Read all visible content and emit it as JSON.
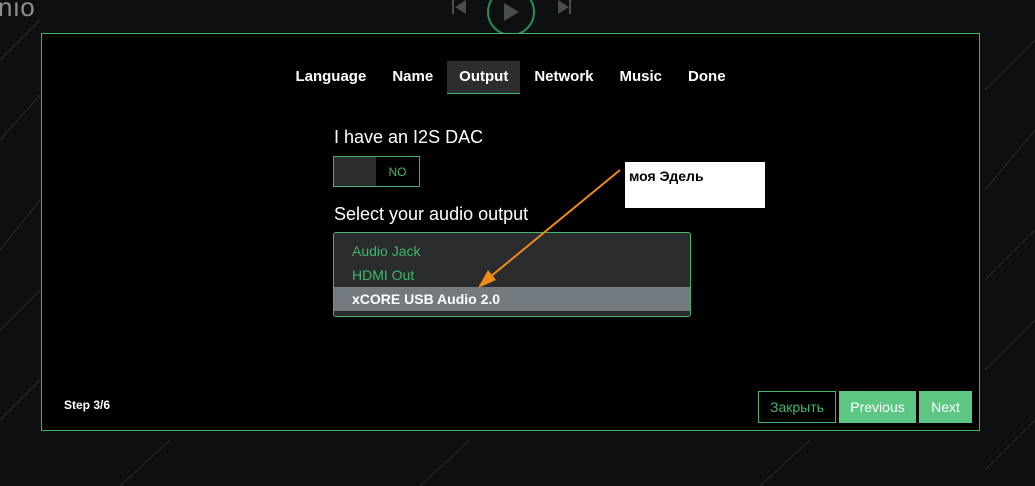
{
  "app": {
    "logo_text": "nio"
  },
  "tabs": [
    {
      "label": "Language"
    },
    {
      "label": "Name"
    },
    {
      "label": "Output"
    },
    {
      "label": "Network"
    },
    {
      "label": "Music"
    },
    {
      "label": "Done"
    }
  ],
  "active_tab": "Output",
  "i2s": {
    "label": "I have an I2S DAC",
    "state": "NO"
  },
  "output": {
    "label": "Select your audio output",
    "options": [
      "Audio Jack",
      "HDMI Out",
      "xCORE USB Audio 2.0"
    ],
    "selected": "xCORE USB Audio 2.0"
  },
  "annotation": {
    "text": "моя Эдель",
    "color": "#f28a1c"
  },
  "footer": {
    "step": "Step 3/6",
    "close_label": "Закрыть",
    "previous_label": "Previous",
    "next_label": "Next"
  },
  "colors": {
    "accent": "#3fb66a",
    "button_fill": "#5cc783",
    "selected_option": "#737a80"
  }
}
